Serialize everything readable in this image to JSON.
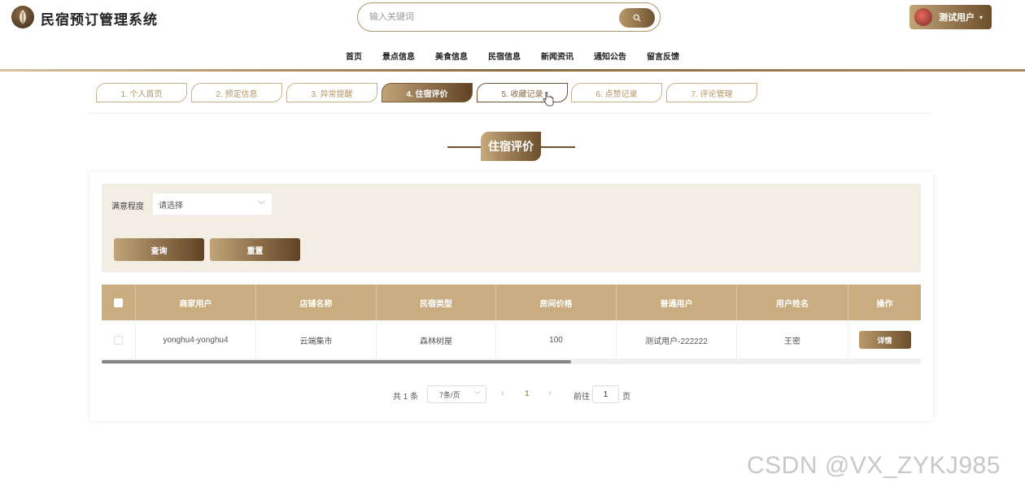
{
  "header": {
    "app_title": "民宿预订管理系统",
    "search_placeholder": "输入关键词",
    "user_name": "测试用户",
    "user_caret": "▾"
  },
  "nav": {
    "items": [
      "首页",
      "景点信息",
      "美食信息",
      "民宿信息",
      "新闻资讯",
      "通知公告",
      "留言反馈"
    ]
  },
  "tabs": [
    {
      "label": "1. 个人首页",
      "state": "normal"
    },
    {
      "label": "2. 预定信息",
      "state": "normal"
    },
    {
      "label": "3. 异常提醒",
      "state": "normal"
    },
    {
      "label": "4. 住宿评价",
      "state": "active"
    },
    {
      "label": "5. 收藏记录",
      "state": "hover"
    },
    {
      "label": "6. 点赞记录",
      "state": "normal"
    },
    {
      "label": "7. 评论管理",
      "state": "normal"
    }
  ],
  "section_title": "住宿评价",
  "filter": {
    "label": "满意程度",
    "select_value": "请选择",
    "query_label": "查询",
    "reset_label": "重置"
  },
  "table": {
    "columns": [
      "商家用户",
      "店铺名称",
      "民宿类型",
      "房间价格",
      "普通用户",
      "用户姓名",
      "操作"
    ],
    "rows": [
      {
        "merchant_user": "yonghu4-yonghu4",
        "shop_name": "云端集市",
        "homestay_type": "森林树屋",
        "room_price": "100",
        "normal_user": "测试用户-222222",
        "user_realname": "王密",
        "action_label": "详情"
      }
    ]
  },
  "pagination": {
    "total_text": "共 1 条",
    "page_size": "7条/页",
    "current_page": "1",
    "goto_label": "前往",
    "goto_value": "1",
    "page_suffix": "页",
    "prev": "‹",
    "next": "›"
  },
  "watermark": "CSDN @VX_ZYKJ985",
  "colors": {
    "accent_light": "#c2a478",
    "accent_dark": "#5f4324",
    "table_header": "#c9ad80",
    "filter_bg": "#f3eee4"
  }
}
